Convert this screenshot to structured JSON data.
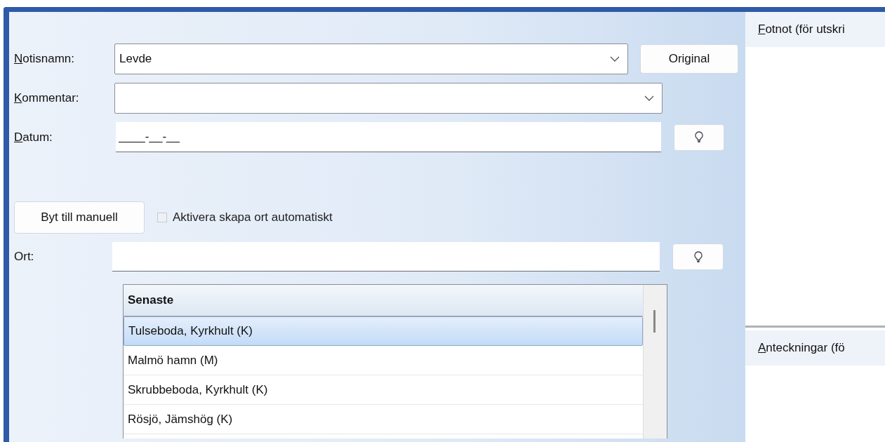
{
  "form": {
    "fields": [
      {
        "kind": "combo",
        "label": "Notisnamn:",
        "mnemonic": true,
        "value": "Levde",
        "button": "Original"
      },
      {
        "kind": "combo",
        "label": "Kommentar:",
        "mnemonic": true
      },
      {
        "kind": "masked",
        "label": "Datum:",
        "mnemonic": true,
        "value": "____-__-__"
      }
    ],
    "manual_button": "Byt till manuell",
    "auto_place": {
      "label": "Aktivera skapa ort automatiskt",
      "checked": false,
      "disabled": true
    },
    "place": {
      "kind": "masked",
      "label": "Ort:",
      "mnemonic": false
    },
    "recent": {
      "header": "Senaste",
      "items": [
        {
          "text": "Tulseboda, Kyrkhult (K)",
          "selected": true
        },
        {
          "text": "Malmö hamn (M)",
          "selected": false
        },
        {
          "text": "Skrubbeboda, Kyrkhult (K)",
          "selected": false
        },
        {
          "text": "Rösjö, Jämshög (K)",
          "selected": false
        }
      ]
    }
  },
  "notes": [
    {
      "title": "Fotnot (för utskri",
      "mnemonic": true
    },
    {
      "title": "Anteckningar (fö",
      "mnemonic": true
    }
  ]
}
